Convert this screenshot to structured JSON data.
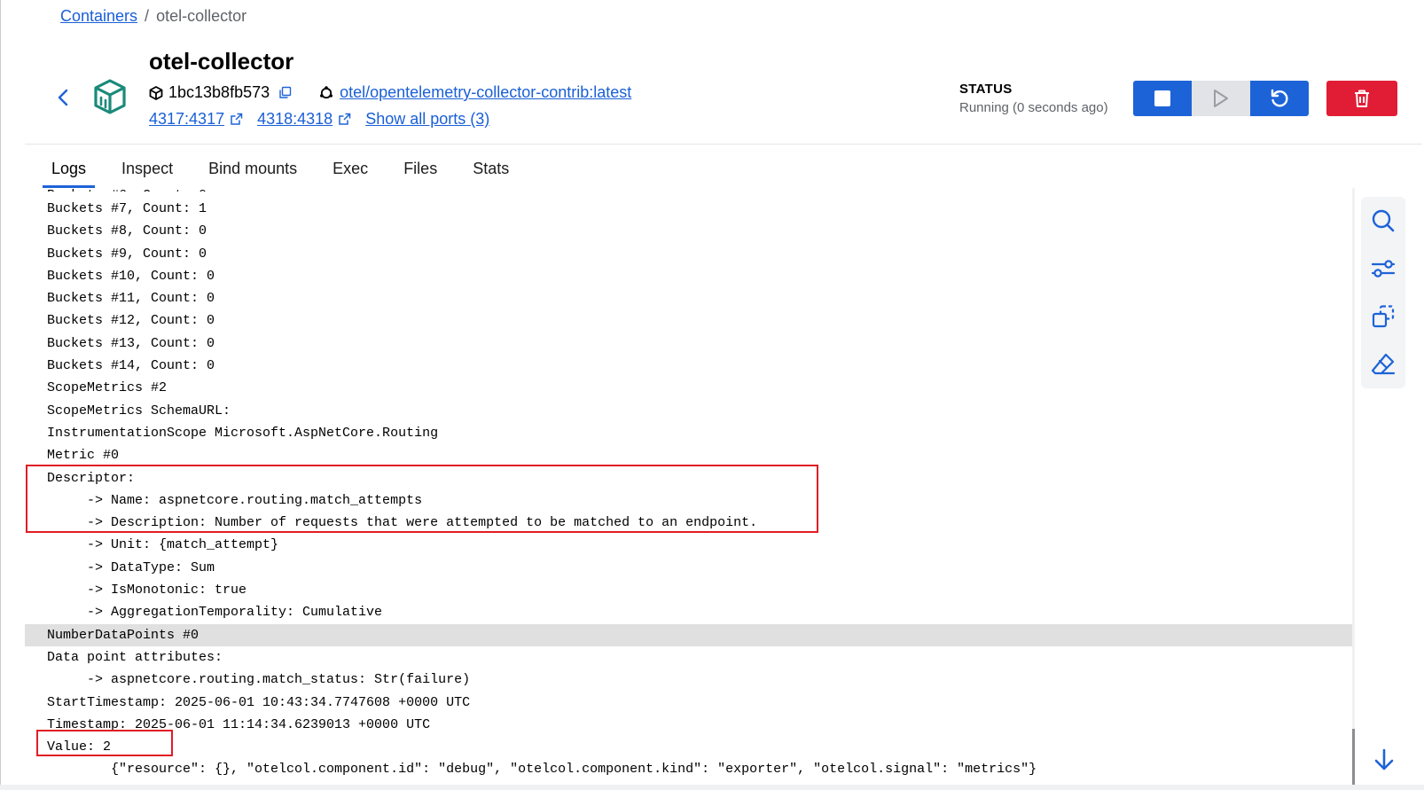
{
  "breadcrumb": {
    "parent": "Containers",
    "separator": "/",
    "current": "otel-collector"
  },
  "container": {
    "name": "otel-collector",
    "id": "1bc13b8fb573",
    "image": "otel/opentelemetry-collector-contrib:latest",
    "ports": [
      "4317:4317",
      "4318:4318"
    ],
    "show_all_ports": "Show all ports (3)"
  },
  "status": {
    "label": "STATUS",
    "value": "Running (0 seconds ago)"
  },
  "actions": {
    "stop_icon": "stop-icon",
    "start_icon": "play-icon",
    "restart_icon": "restart-icon",
    "delete_icon": "trash-icon"
  },
  "colors": {
    "primary": "#1d63d8",
    "danger": "#e11d35",
    "link": "#1a5fd6",
    "teal": "#1a8a7a",
    "highlight_box": "#e11d24"
  },
  "tabs": [
    "Logs",
    "Inspect",
    "Bind mounts",
    "Exec",
    "Files",
    "Stats"
  ],
  "active_tab": "Logs",
  "side_tools": [
    "search-icon",
    "filter-icon",
    "copy-icon",
    "eraser-icon"
  ],
  "logs": [
    "Buckets #7, Count: 1",
    "Buckets #8, Count: 0",
    "Buckets #9, Count: 0",
    "Buckets #10, Count: 0",
    "Buckets #11, Count: 0",
    "Buckets #12, Count: 0",
    "Buckets #13, Count: 0",
    "Buckets #14, Count: 0",
    "ScopeMetrics #2",
    "ScopeMetrics SchemaURL:",
    "InstrumentationScope Microsoft.AspNetCore.Routing",
    "Metric #0",
    "Descriptor:",
    "     -> Name: aspnetcore.routing.match_attempts",
    "     -> Description: Number of requests that were attempted to be matched to an endpoint.",
    "     -> Unit: {match_attempt}",
    "     -> DataType: Sum",
    "     -> IsMonotonic: true",
    "     -> AggregationTemporality: Cumulative",
    "NumberDataPoints #0",
    "Data point attributes:",
    "     -> aspnetcore.routing.match_status: Str(failure)",
    "StartTimestamp: 2025-06-01 10:43:34.7747608 +0000 UTC",
    "Timestamp: 2025-06-01 11:14:34.6239013 +0000 UTC",
    "Value: 2",
    "        {\"resource\": {}, \"otelcol.component.id\": \"debug\", \"otelcol.component.kind\": \"exporter\", \"otelcol.signal\": \"metrics\"}"
  ],
  "highlighted_line_index": 19
}
